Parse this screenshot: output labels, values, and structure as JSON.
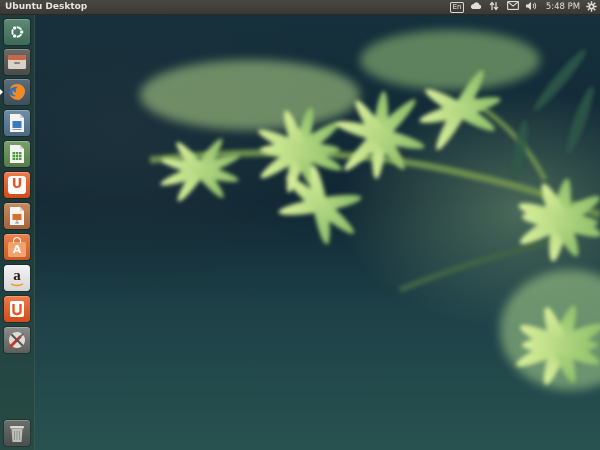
{
  "panel": {
    "title": "Ubuntu Desktop",
    "keyboard_layout": "En",
    "time": "5:48 PM",
    "indicators": [
      "cloud-icon",
      "network-transfer-icon",
      "mail-icon",
      "volume-icon",
      "settings-gear-icon"
    ]
  },
  "launcher": {
    "items": [
      {
        "name": "dash-home",
        "icon": "ubuntu-logo-icon"
      },
      {
        "name": "files",
        "icon": "file-cabinet-icon"
      },
      {
        "name": "firefox",
        "icon": "firefox-icon"
      },
      {
        "name": "libreoffice-writer",
        "icon": "writer-document-icon"
      },
      {
        "name": "libreoffice-calc",
        "icon": "calc-spreadsheet-icon"
      },
      {
        "name": "ubuntu-one",
        "icon": "ubuntu-one-icon",
        "label": "U"
      },
      {
        "name": "libreoffice-impress",
        "icon": "impress-presentation-icon"
      },
      {
        "name": "software-center",
        "icon": "shopping-bag-icon",
        "label": "A"
      },
      {
        "name": "amazon",
        "icon": "amazon-icon",
        "label": "a"
      },
      {
        "name": "ubuntu-one-music",
        "icon": "ubuntu-one-music-icon"
      },
      {
        "name": "system-settings",
        "icon": "wrench-screwdriver-icon"
      },
      {
        "name": "trash",
        "icon": "trash-icon"
      }
    ]
  },
  "colors": {
    "panel_bg": "#3c3b37",
    "ubuntu_orange": "#e95420",
    "launcher_bg": "#2e4a40"
  }
}
